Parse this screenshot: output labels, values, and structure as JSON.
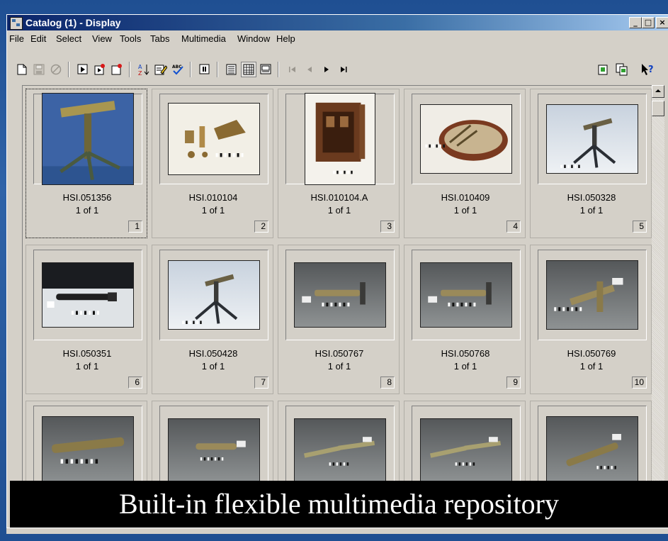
{
  "window": {
    "title": "Catalog (1) - Display",
    "minimize_glyph": "_",
    "maximize_glyph": "□",
    "close_glyph": "×"
  },
  "menu": [
    "File",
    "Edit",
    "Select",
    "View",
    "Tools",
    "Tabs",
    "Multimedia",
    "Window",
    "Help"
  ],
  "toolbar_icons": [
    "new-document-icon",
    "save-icon",
    "cancel-icon",
    "record-icon",
    "record-next-icon",
    "record-prev-icon",
    "sort-az-icon",
    "edit-icon",
    "spellcheck-icon",
    "info-icon",
    "form-view-icon",
    "grid-view-icon",
    "display-view-icon",
    "first-record-icon",
    "previous-record-icon",
    "next-record-icon",
    "last-record-icon",
    "multimedia-icon",
    "copy-icon",
    "whats-this-icon"
  ],
  "colors": {
    "background_blue": "#1f4f92",
    "titlebar_start": "#0a246a",
    "titlebar_end": "#a6caf0",
    "window_face": "#d4d0c8",
    "caption_bg": "#000000"
  },
  "tiles": [
    {
      "id": "HSI.051356",
      "of": "1 of 1",
      "num": "1",
      "photo": "tripod-blue"
    },
    {
      "id": "HSI.010104",
      "of": "1 of 1",
      "num": "2",
      "photo": "parts-white"
    },
    {
      "id": "HSI.010104.A",
      "of": "1 of 1",
      "num": "3",
      "photo": "wooden-case"
    },
    {
      "id": "HSI.010409",
      "of": "1 of 1",
      "num": "4",
      "photo": "case-open"
    },
    {
      "id": "HSI.050328",
      "of": "1 of 1",
      "num": "5",
      "photo": "tripod-light"
    },
    {
      "id": "HSI.050351",
      "of": "1 of 1",
      "num": "6",
      "photo": "tube-dark"
    },
    {
      "id": "HSI.050428",
      "of": "1 of 1",
      "num": "7",
      "photo": "tripod-light"
    },
    {
      "id": "HSI.050767",
      "of": "1 of 1",
      "num": "8",
      "photo": "level-gray"
    },
    {
      "id": "HSI.050768",
      "of": "1 of 1",
      "num": "9",
      "photo": "level-gray"
    },
    {
      "id": "HSI.050769",
      "of": "1 of 1",
      "num": "10",
      "photo": "level-angled"
    },
    {
      "id": "",
      "of": "",
      "num": "",
      "photo": "tube-gray"
    },
    {
      "id": "",
      "of": "",
      "num": "",
      "photo": "tube-short"
    },
    {
      "id": "",
      "of": "",
      "num": "",
      "photo": "rods-gray"
    },
    {
      "id": "",
      "of": "",
      "num": "",
      "photo": "rods-gray"
    },
    {
      "id": "",
      "of": "",
      "num": "",
      "photo": "tube-diagonal"
    }
  ],
  "caption": "Built-in flexible multimedia repository"
}
